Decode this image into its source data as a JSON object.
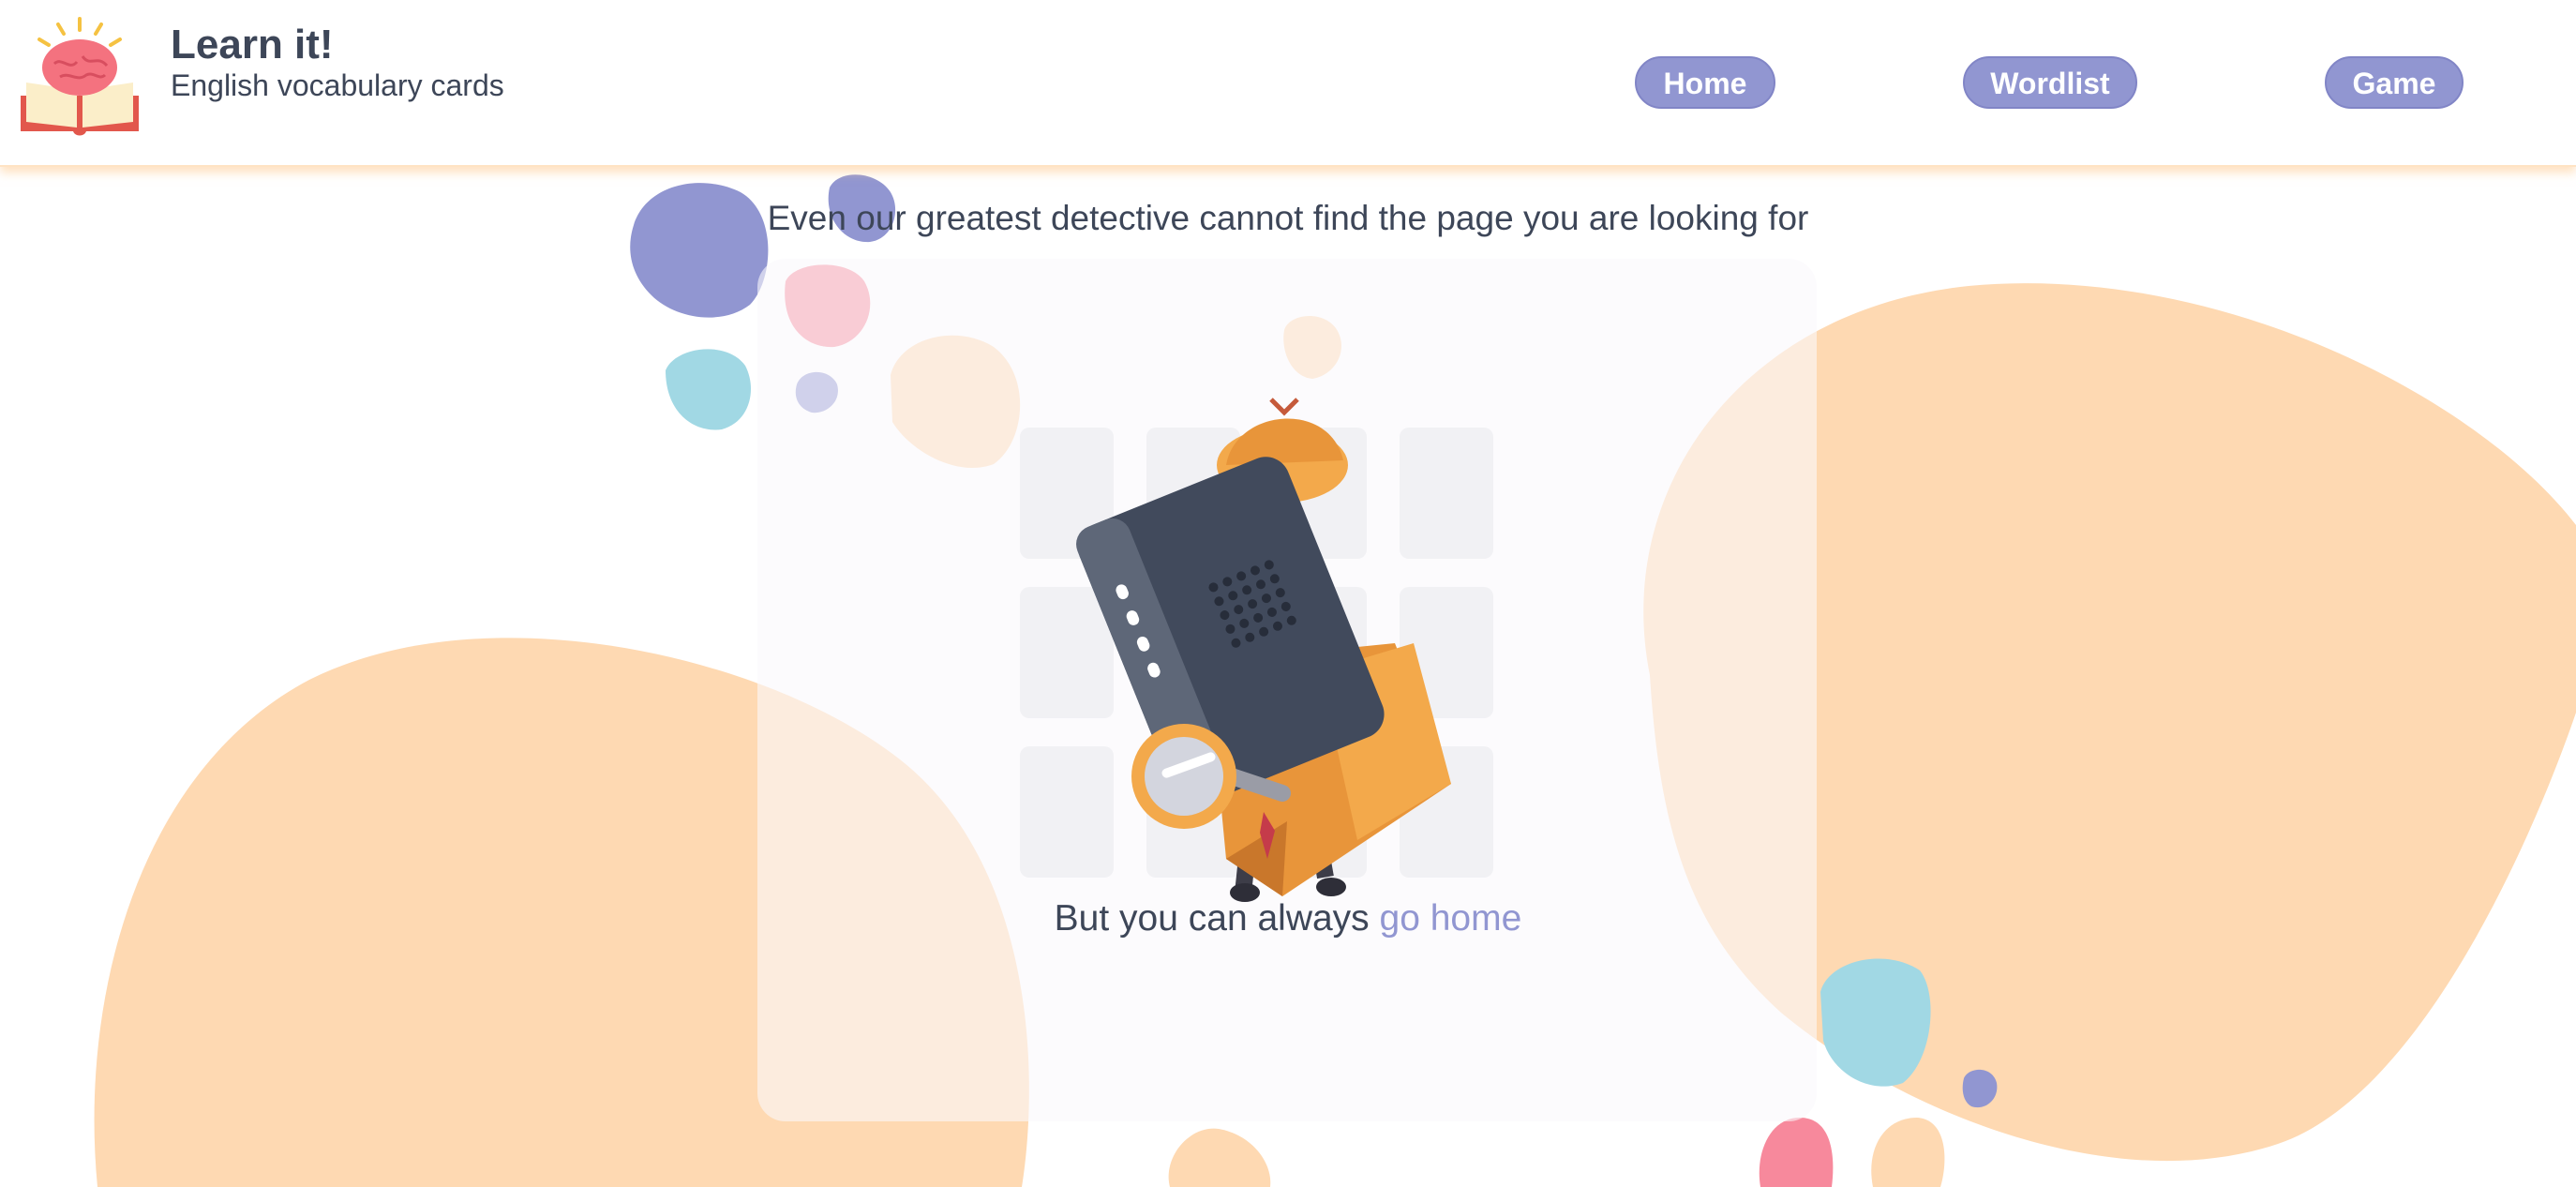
{
  "app": {
    "title": "Learn it!",
    "subtitle": "English vocabulary cards",
    "logo_icon": "brain-book-icon"
  },
  "nav": {
    "items": [
      {
        "label": "Home"
      },
      {
        "label": "Wordlist"
      },
      {
        "label": "Game"
      }
    ]
  },
  "main": {
    "message": "Even our greatest detective cannot find the page you are looking for",
    "subtext_prefix": "But you can always ",
    "go_home_link": "go home",
    "illustration_icon": "detective-computer-illustration"
  },
  "colors": {
    "accent": "#9196d1",
    "text": "#3d4658",
    "blob_peach": "#fed9b2",
    "blob_pink": "#f7899c",
    "blob_cyan": "#a1d8e4",
    "blob_purple": "#9196d1"
  }
}
